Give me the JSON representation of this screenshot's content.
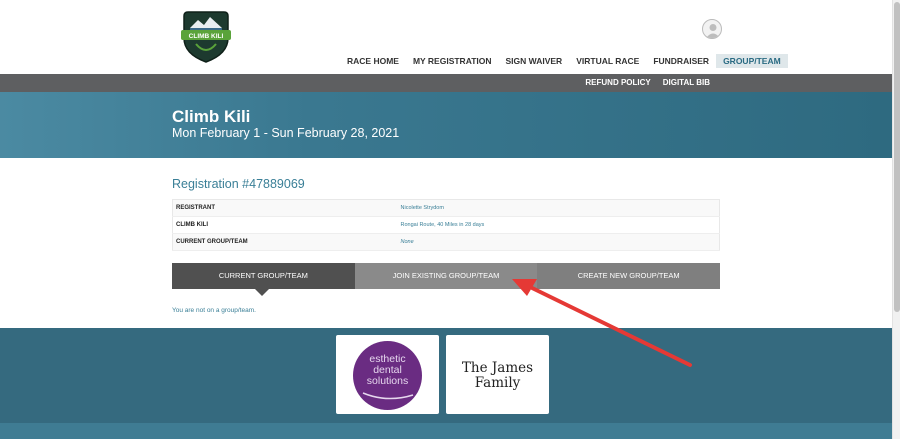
{
  "header": {
    "logo_text": "CLIMB KILI",
    "nav": [
      {
        "label": "RACE HOME",
        "active": false
      },
      {
        "label": "MY REGISTRATION",
        "active": false
      },
      {
        "label": "SIGN WAIVER",
        "active": false
      },
      {
        "label": "VIRTUAL RACE",
        "active": false
      },
      {
        "label": "FUNDRAISER",
        "active": false
      },
      {
        "label": "GROUP/TEAM",
        "active": true
      }
    ],
    "subnav": [
      {
        "label": "REFUND POLICY"
      },
      {
        "label": "DIGITAL BIB"
      }
    ]
  },
  "banner": {
    "title": "Climb Kili",
    "dates": "Mon February 1 - Sun February 28, 2021"
  },
  "registration": {
    "title": "Registration #47889069",
    "rows": [
      {
        "key": "REGISTRANT",
        "value": "Nicolette Strydom"
      },
      {
        "key": "CLIMB KILI",
        "value": "Rongai Route, 40 Miles in 28 days"
      },
      {
        "key": "CURRENT GROUP/TEAM",
        "value": "None"
      }
    ]
  },
  "tabs": [
    {
      "label": "CURRENT GROUP/TEAM",
      "selected": true
    },
    {
      "label": "JOIN EXISTING GROUP/TEAM",
      "selected": false
    },
    {
      "label": "CREATE NEW GROUP/TEAM",
      "selected": false
    }
  ],
  "status_text": "You are not on a group/team.",
  "sponsors": [
    {
      "name": "esthetic dental solutions",
      "lines": [
        "esthetic",
        "dental",
        "solutions"
      ]
    },
    {
      "name": "The James Family",
      "lines": [
        "The James",
        "Family"
      ]
    }
  ],
  "colors": {
    "accent": "#3a7f97",
    "banner": "#3a7890",
    "subbar": "#5e5f61",
    "tab_current": "#505050",
    "tab_inactive": "#8a8a8a",
    "sponsor_bg": "#356a7f",
    "annotation_arrow": "#e53935"
  }
}
